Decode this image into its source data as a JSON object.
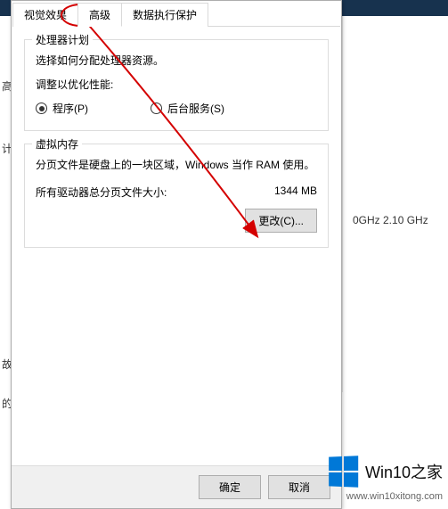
{
  "tabs": {
    "visual": "视觉效果",
    "advanced": "高级",
    "dep": "数据执行保护"
  },
  "scheduler": {
    "title": "处理器计划",
    "desc": "选择如何分配处理器资源。",
    "adjust_label": "调整以优化性能:",
    "program_label": "程序(P)",
    "service_label": "后台服务(S)"
  },
  "vmem": {
    "title": "虚拟内存",
    "desc": "分页文件是硬盘上的一块区域，Windows 当作 RAM 使用。",
    "total_label": "所有驱动器总分页文件大小:",
    "total_value": "1344 MB",
    "change_btn": "更改(C)..."
  },
  "footer": {
    "ok": "确定",
    "cancel": "取消"
  },
  "background": {
    "cpu_freq": "0GHz   2.10 GHz",
    "left_label1": "高级",
    "left_label2": "计",
    "left_label3": "故障",
    "left_label4": "的桌"
  },
  "watermark": {
    "title": "Win10之家",
    "url": "www.win10xitong.com"
  }
}
